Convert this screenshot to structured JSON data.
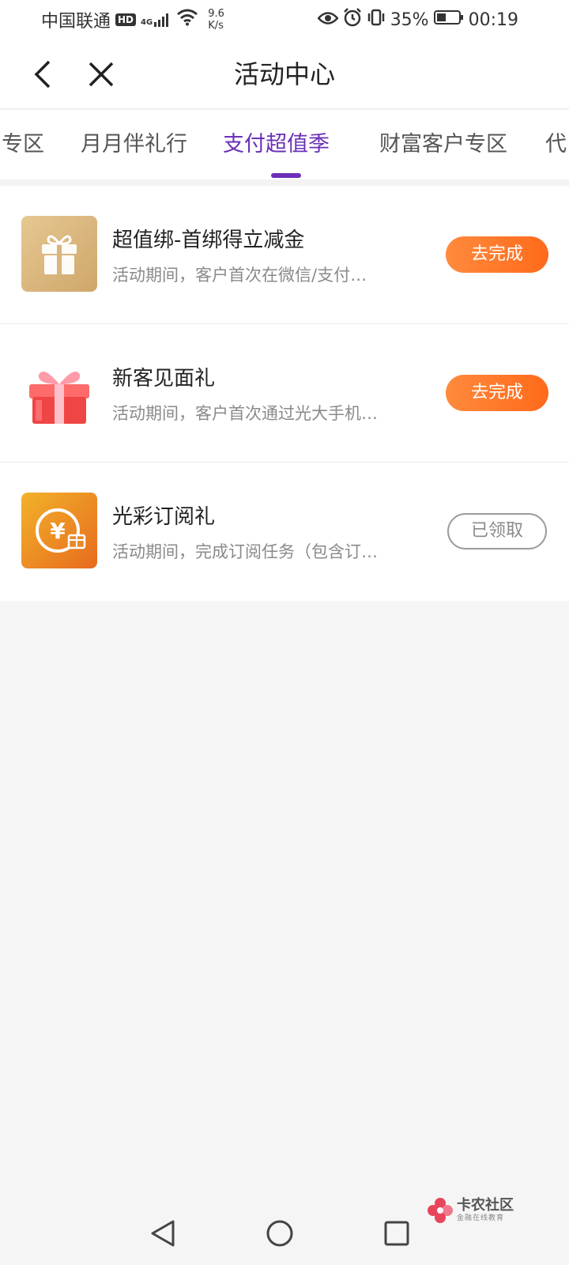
{
  "status_bar": {
    "carrier": "中国联通",
    "hd_badge": "HD",
    "signal_tech": "4G",
    "net_speed_value": "9.6",
    "net_speed_unit": "K/s",
    "battery": "35%",
    "time": "00:19"
  },
  "header": {
    "title": "活动中心"
  },
  "tabs": [
    {
      "label": "专区"
    },
    {
      "label": "月月伴礼行"
    },
    {
      "label": "支付超值季",
      "active": true
    },
    {
      "label": "财富客户专区"
    },
    {
      "label": "代"
    }
  ],
  "activities": [
    {
      "title": "超值绑-首绑得立减金",
      "desc": "活动期间，客户首次在微信/支付…",
      "button": "去完成",
      "icon": "gift-box-icon"
    },
    {
      "title": "新客见面礼",
      "desc": "活动期间，客户首次通过光大手机…",
      "button": "去完成",
      "icon": "red-gift-icon"
    },
    {
      "title": "光彩订阅礼",
      "desc": "活动期间，完成订阅任务（包含订…",
      "button": "已领取",
      "icon": "yen-coin-icon"
    }
  ],
  "watermark": {
    "main": "卡农社区",
    "sub": "金融在线教育"
  },
  "colors": {
    "accent": "#6b2fb8",
    "button_orange": "#ff7a28"
  }
}
